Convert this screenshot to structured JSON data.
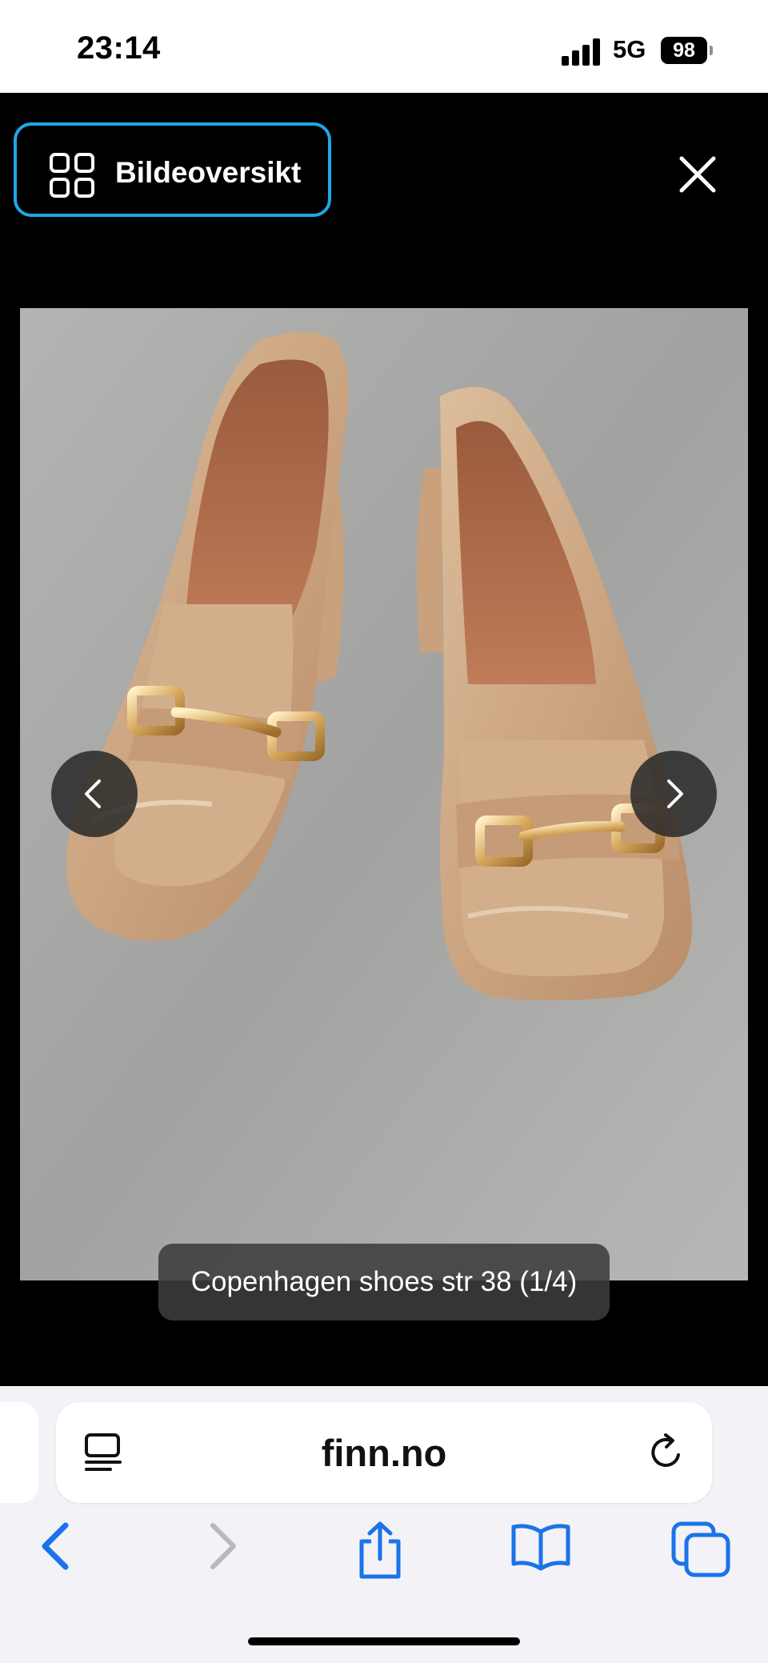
{
  "status_bar": {
    "time": "23:14",
    "network": "5G",
    "battery": "98"
  },
  "viewer": {
    "gallery_button_label": "Bildeoversikt",
    "caption": "Copenhagen shoes str 38 (1/4)",
    "accent_color": "#1fa7e6",
    "icons": {
      "gallery": "grid-icon",
      "close": "close-icon",
      "previous": "chevron-left-icon",
      "next": "chevron-right-icon"
    }
  },
  "browser": {
    "domain": "finn.no",
    "accent_color": "#1a73e8",
    "icons": [
      "reader-mode-icon",
      "reload-icon",
      "back-icon",
      "forward-icon",
      "share-icon",
      "bookmarks-icon",
      "tabs-icon"
    ]
  }
}
